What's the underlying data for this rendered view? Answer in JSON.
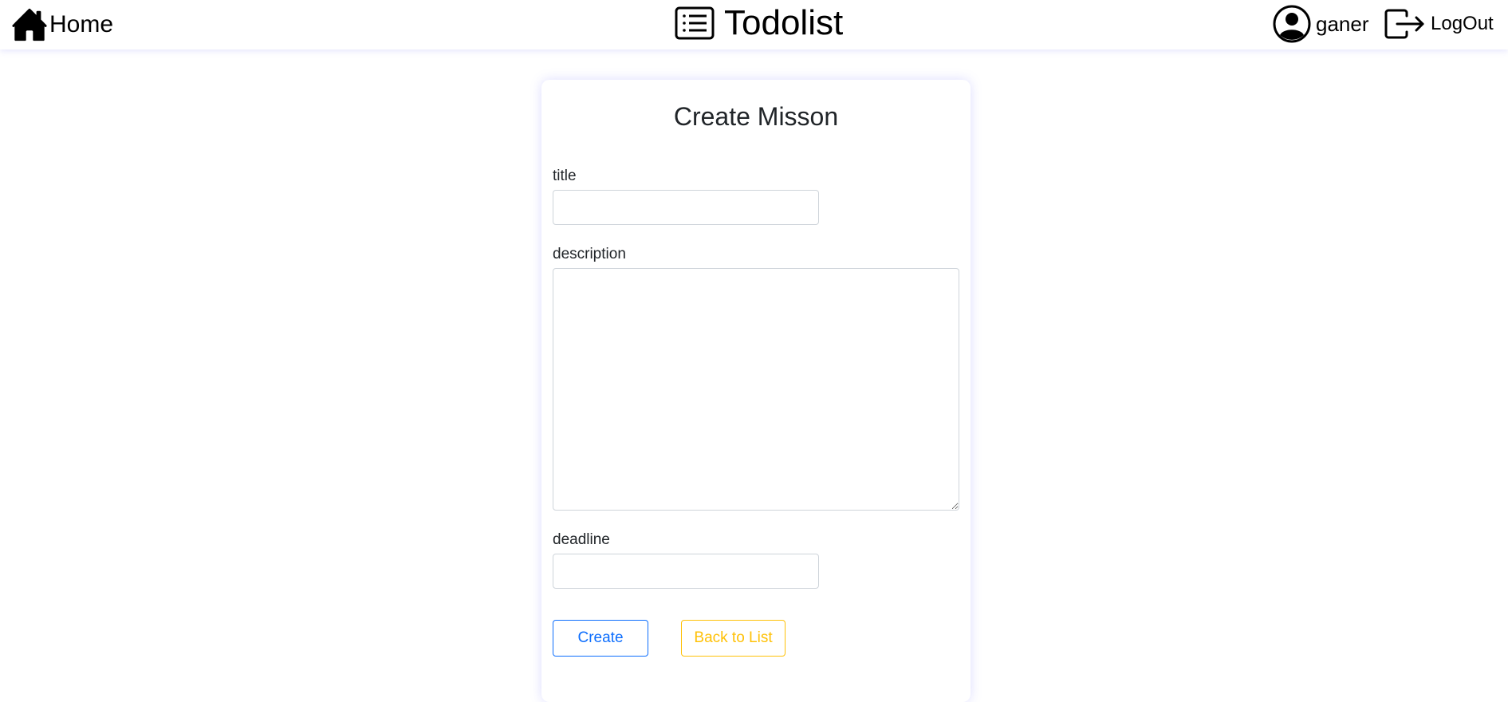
{
  "navbar": {
    "home_label": "Home",
    "brand_label": "Todolist",
    "username": "ganer",
    "logout_label": "LogOut"
  },
  "form": {
    "heading": "Create Misson",
    "title_label": "title",
    "title_value": "",
    "description_label": "description",
    "description_value": "",
    "deadline_label": "deadline",
    "deadline_value": "",
    "create_label": "Create",
    "back_label": "Back to List"
  },
  "colors": {
    "primary": "#0d6efd",
    "warning": "#ffc107"
  }
}
